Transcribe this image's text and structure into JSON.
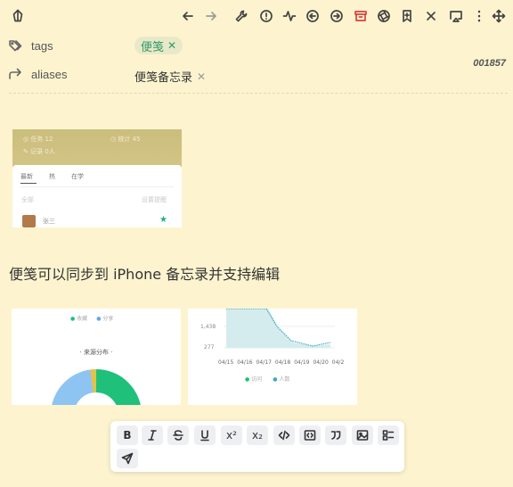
{
  "toolbar": {
    "icons": [
      "logo-icon",
      "back-icon",
      "forward-icon",
      "wrench-icon",
      "alert-icon",
      "activity-icon",
      "circle-left-icon",
      "circle-right-icon",
      "archive-icon",
      "aperture-icon",
      "bookmark-add-icon",
      "close-icon",
      "cast-icon",
      "more-vertical-icon",
      "move-icon"
    ]
  },
  "properties": {
    "tags": {
      "key": "tags",
      "value": "便笺",
      "remove": "✕"
    },
    "aliases": {
      "key": "aliases",
      "value": "便笺备忘录",
      "remove": "✕"
    }
  },
  "note_id": "001857",
  "content": {
    "caption": "便笺可以同步到 iPhone 备忘录并支持编辑",
    "shot1": {
      "tabs": [
        "最新",
        "热",
        "在学"
      ],
      "row_label": "全部",
      "row_right": "设置提醒",
      "user": "张三"
    },
    "shot2": {
      "legend": [
        "收藏",
        "分享"
      ],
      "title": "· 来源分布 ·"
    },
    "shot3": {
      "y_labels": [
        "1,438",
        "277"
      ],
      "x_labels": [
        "04/15",
        "04/16",
        "04/17",
        "04/18",
        "04/19",
        "04/20",
        "04/2"
      ],
      "legend": [
        "访问",
        "人数"
      ]
    }
  },
  "format_toolbar": {
    "buttons": [
      "bold",
      "italic",
      "strikethrough",
      "underline",
      "superscript",
      "subscript",
      "code",
      "code-block",
      "quote",
      "image",
      "checklist",
      "send"
    ],
    "bold": "B",
    "superscript": "x²",
    "subscript": "x₂"
  },
  "colors": {
    "background": "#fdf4cf",
    "tag_text": "#2f9a6a",
    "archive_icon": "#d8413e",
    "donut_green": "#1fc07a",
    "donut_blue": "#8ec4f2",
    "line_teal": "#4fb3c7"
  }
}
